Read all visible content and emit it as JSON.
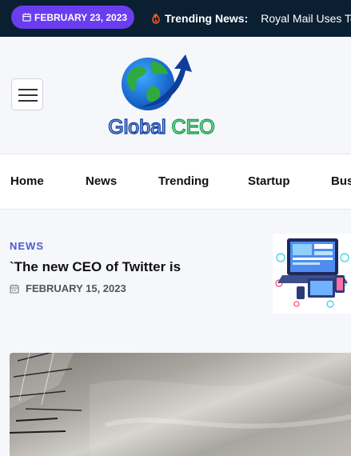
{
  "topbar": {
    "date": "FEBRUARY 23, 2023",
    "trending_label": "Trending News:",
    "trending_headline": "Royal Mail Uses Tech"
  },
  "logo": {
    "text": "Global CEO"
  },
  "nav": {
    "items": [
      "Home",
      "News",
      "Trending",
      "Startup",
      "Bus"
    ]
  },
  "post": {
    "category": "NEWS",
    "title": "`The new CEO of Twitter is",
    "date": "FEBRUARY 15, 2023"
  },
  "icons": {
    "calendar": "calendar-icon",
    "fire": "fire-icon",
    "menu": "hamburger-menu-icon",
    "globe": "globe-arrow-icon"
  },
  "colors": {
    "topbar_bg": "#0b1f33",
    "date_pill": "#6a3ef0",
    "accent": "#4c5bd4",
    "fire": "#ff5a1f"
  }
}
